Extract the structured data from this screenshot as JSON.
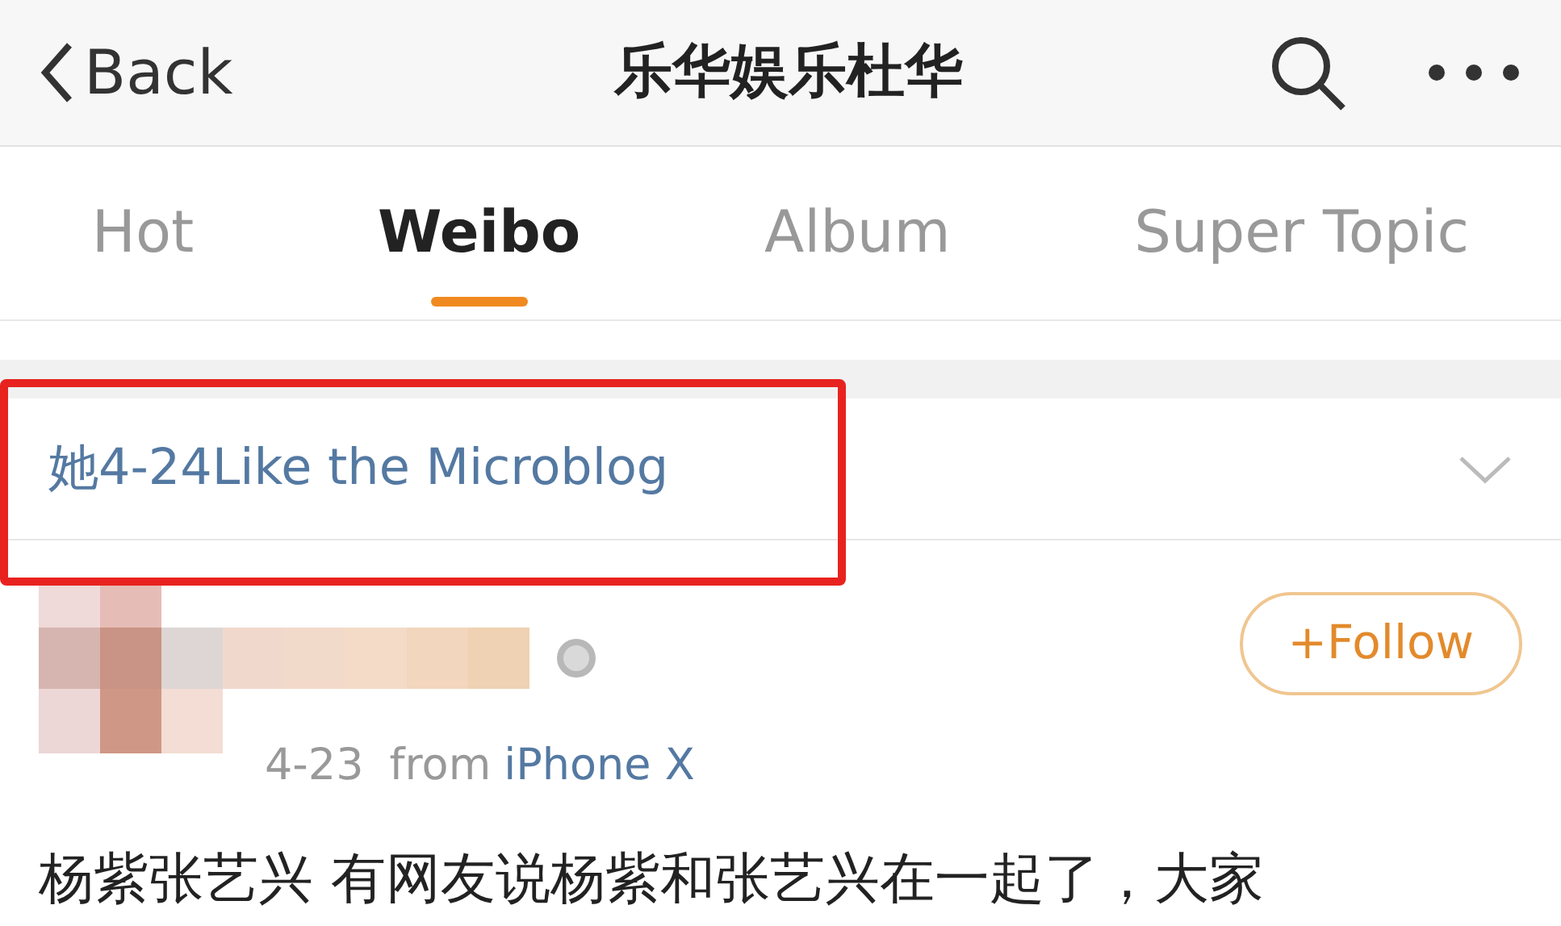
{
  "header": {
    "back": "Back",
    "title": "乐华娱乐杜华"
  },
  "tabs": [
    {
      "label": "Hot",
      "selected": false
    },
    {
      "label": "Weibo",
      "selected": true
    },
    {
      "label": "Album",
      "selected": false
    },
    {
      "label": "Super Topic",
      "selected": false
    }
  ],
  "filter": {
    "label": "她4-24Like the Microblog",
    "highlighted": true
  },
  "post": {
    "date": "4-23",
    "source_prefix": "from",
    "source": "iPhone X",
    "follow": "+Follow",
    "text": "杨紫张艺兴 有网友说杨紫和张艺兴在一起了，大家"
  }
}
